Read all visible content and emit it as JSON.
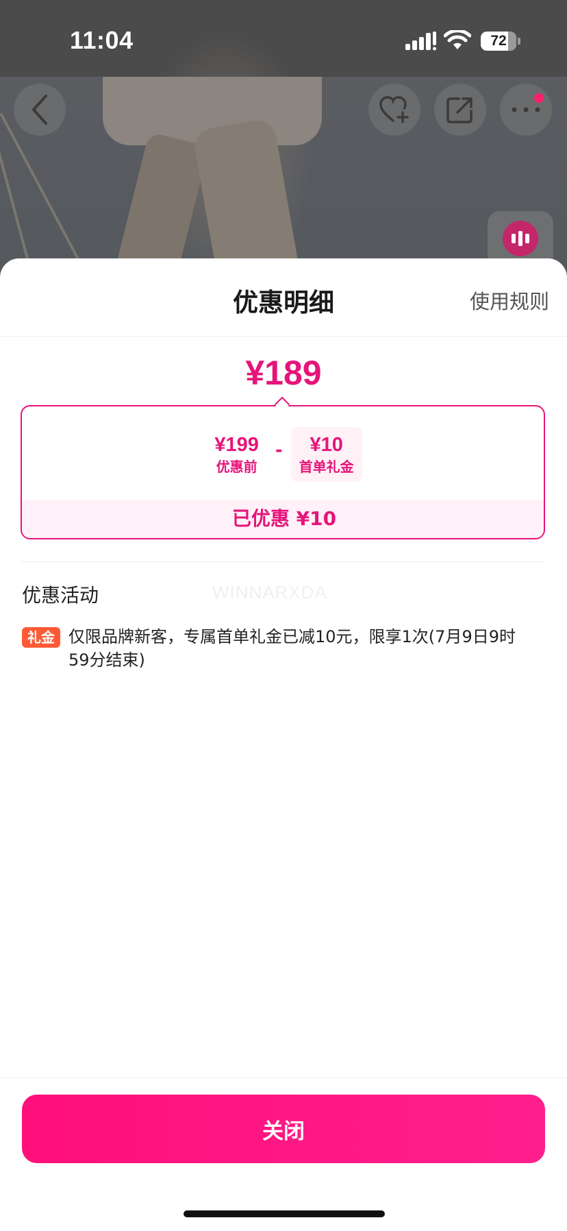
{
  "status_bar": {
    "time": "11:04",
    "battery_level": "72",
    "icons": [
      "cellular-signal-icon",
      "wifi-icon",
      "battery-icon"
    ]
  },
  "nav": {
    "icons": [
      "back-arrow-icon",
      "heart-plus-icon",
      "share-icon",
      "more-dots-icon"
    ],
    "more_has_badge": true
  },
  "sheet": {
    "title": "优惠明细",
    "rules_link": "使用规则",
    "final_price": "¥189",
    "breakdown": {
      "original": {
        "value": "¥199",
        "label": "优惠前"
      },
      "operator": "-",
      "discount": {
        "value": "¥10",
        "label": "首单礼金"
      },
      "saved_text": "已优惠 ¥10"
    },
    "section_title": "优惠活动",
    "watermark": "WINNARXDA",
    "promotion": {
      "tag": "礼金",
      "text": "仅限品牌新客，专属首单礼金已减10元，限享1次(7月9日9时59分结束)"
    },
    "close_button": "关闭"
  },
  "colors": {
    "accent": "#e6147a",
    "button": "#ff0f7b",
    "tag": "#ff5a36",
    "highlight_bg": "#fff1f7"
  }
}
